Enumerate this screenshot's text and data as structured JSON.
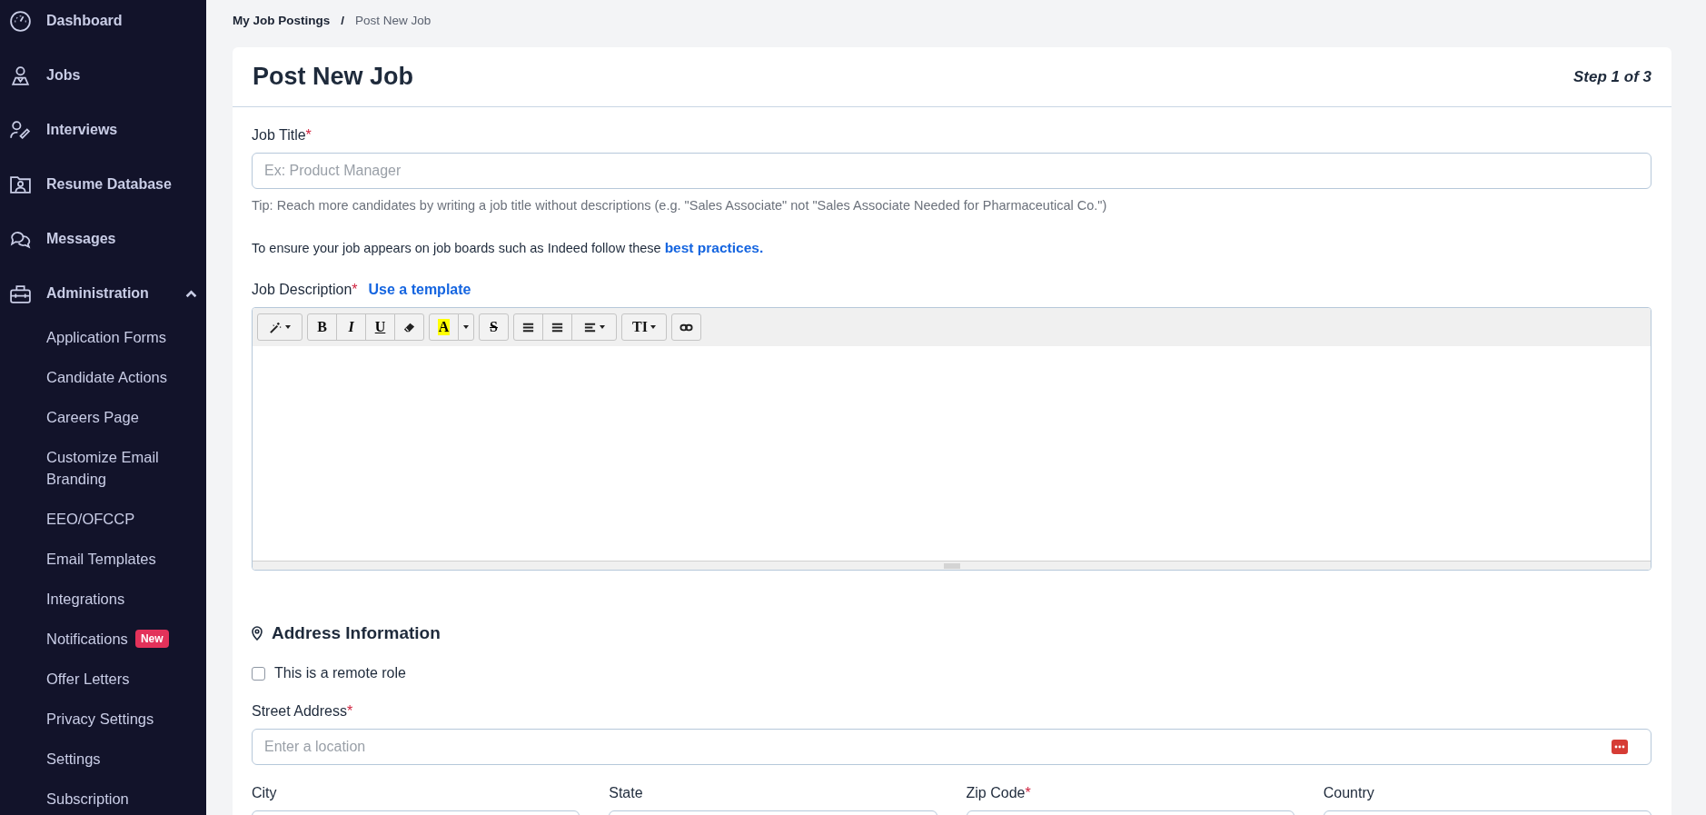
{
  "sidebar": {
    "items": [
      {
        "kind": "dashboard",
        "label": "Dashboard"
      },
      {
        "kind": "jobs",
        "label": "Jobs"
      },
      {
        "kind": "interviews",
        "label": "Interviews"
      },
      {
        "kind": "resume",
        "label": "Resume Database"
      },
      {
        "kind": "messages",
        "label": "Messages"
      },
      {
        "kind": "admin",
        "label": "Administration",
        "expanded": true,
        "children": [
          {
            "label": "Application Forms"
          },
          {
            "label": "Candidate Actions"
          },
          {
            "label": "Careers Page"
          },
          {
            "label": "Customize Email Branding"
          },
          {
            "label": "EEO/OFCCP"
          },
          {
            "label": "Email Templates"
          },
          {
            "label": "Integrations"
          },
          {
            "label": "Notifications",
            "badge": "New"
          },
          {
            "label": "Offer Letters"
          },
          {
            "label": "Privacy Settings"
          },
          {
            "label": "Settings"
          },
          {
            "label": "Subscription"
          }
        ]
      }
    ]
  },
  "breadcrumb": {
    "items": [
      "My Job Postings",
      "Post New Job"
    ],
    "separator": "/"
  },
  "card": {
    "title": "Post New Job",
    "step": "Step 1 of 3"
  },
  "job_title": {
    "label": "Job Title",
    "required_mark": "*",
    "placeholder": "Ex: Product Manager",
    "tip": "Tip: Reach more candidates by writing a job title without descriptions (e.g. \"Sales Associate\" not \"Sales Associate Needed for Pharmaceutical Co.\")"
  },
  "notice": {
    "text": "To ensure your job appears on job boards such as Indeed follow these",
    "link": "best practices."
  },
  "job_description": {
    "label": "Job Description",
    "required_mark": "*",
    "template_link": "Use a template",
    "toolbar": [
      [
        {
          "kind": "magic"
        }
      ],
      [
        {
          "kind": "bold",
          "label": "B"
        },
        {
          "kind": "italic",
          "label": "I"
        },
        {
          "kind": "underline",
          "label": "U"
        },
        {
          "kind": "eraser"
        }
      ],
      [
        {
          "kind": "color",
          "label": "A"
        },
        {
          "kind": "caret"
        }
      ],
      [
        {
          "kind": "strike",
          "label": "S"
        }
      ],
      [
        {
          "kind": "ul"
        },
        {
          "kind": "ol"
        },
        {
          "kind": "align"
        }
      ],
      [
        {
          "kind": "fontsize",
          "label": "TI"
        }
      ],
      [
        {
          "kind": "link"
        }
      ]
    ]
  },
  "address": {
    "heading": "Address Information",
    "remote": {
      "label": "This is a remote role",
      "checked": false
    },
    "street": {
      "label": "Street Address",
      "required_mark": "*",
      "placeholder": "Enter a location"
    },
    "fields": [
      {
        "label": "City"
      },
      {
        "label": "State"
      },
      {
        "label": "Zip Code",
        "required_mark": "*"
      },
      {
        "label": "Country"
      }
    ]
  }
}
